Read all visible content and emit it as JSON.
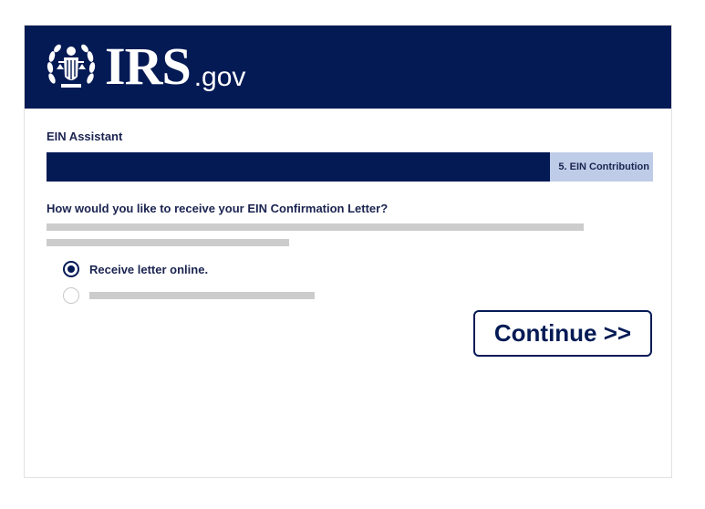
{
  "header": {
    "logo_text": "IRS",
    "logo_suffix": ".gov",
    "logo_icon": "irs-eagle-icon"
  },
  "assistant": {
    "title": "EIN Assistant"
  },
  "progress": {
    "step_label": "5. EIN Contribution",
    "completed_fraction": 0.83
  },
  "question": {
    "text": "How would you like to receive your EIN Confirmation Letter?"
  },
  "options": [
    {
      "label": "Receive letter online.",
      "selected": true
    },
    {
      "label": "",
      "selected": false
    }
  ],
  "actions": {
    "continue_label": "Continue >>"
  },
  "colors": {
    "brand_navy": "#041a55",
    "progress_track": "#bfcce8",
    "placeholder_gray": "#cccccc"
  }
}
